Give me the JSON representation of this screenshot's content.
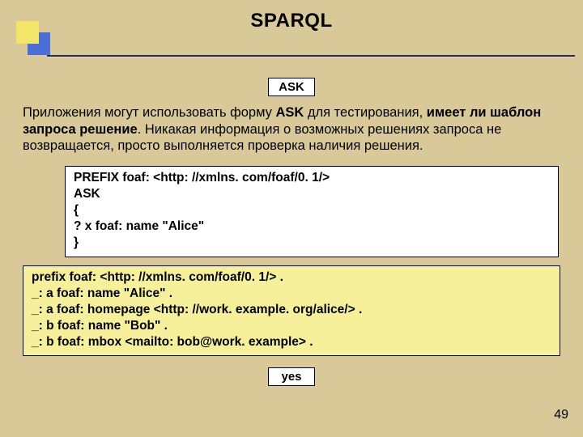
{
  "title": "SPARQL",
  "ask_label": "ASK",
  "body": {
    "part1": "Приложения могут использовать форму ",
    "bold1": "ASK",
    "part2": " для тестирования, ",
    "bold2": "имеет ли шаблон запроса решение",
    "part3": ".\nНикакая информация о возможных решениях запроса не возвращается, просто выполняется проверка наличия решения."
  },
  "code_white": "PREFIX foaf: <http: //xmlns. com/foaf/0. 1/>\nASK\n{\n? x foaf: name \"Alice\"\n}",
  "code_yellow": "prefix foaf: <http: //xmlns. com/foaf/0. 1/> .\n_: a foaf: name \"Alice\" .\n_: a foaf: homepage <http: //work. example. org/alice/> .\n_: b foaf: name \"Bob\" .\n_: b foaf: mbox <mailto: bob@work. example> .",
  "result_label": "yes",
  "page_number": "49"
}
